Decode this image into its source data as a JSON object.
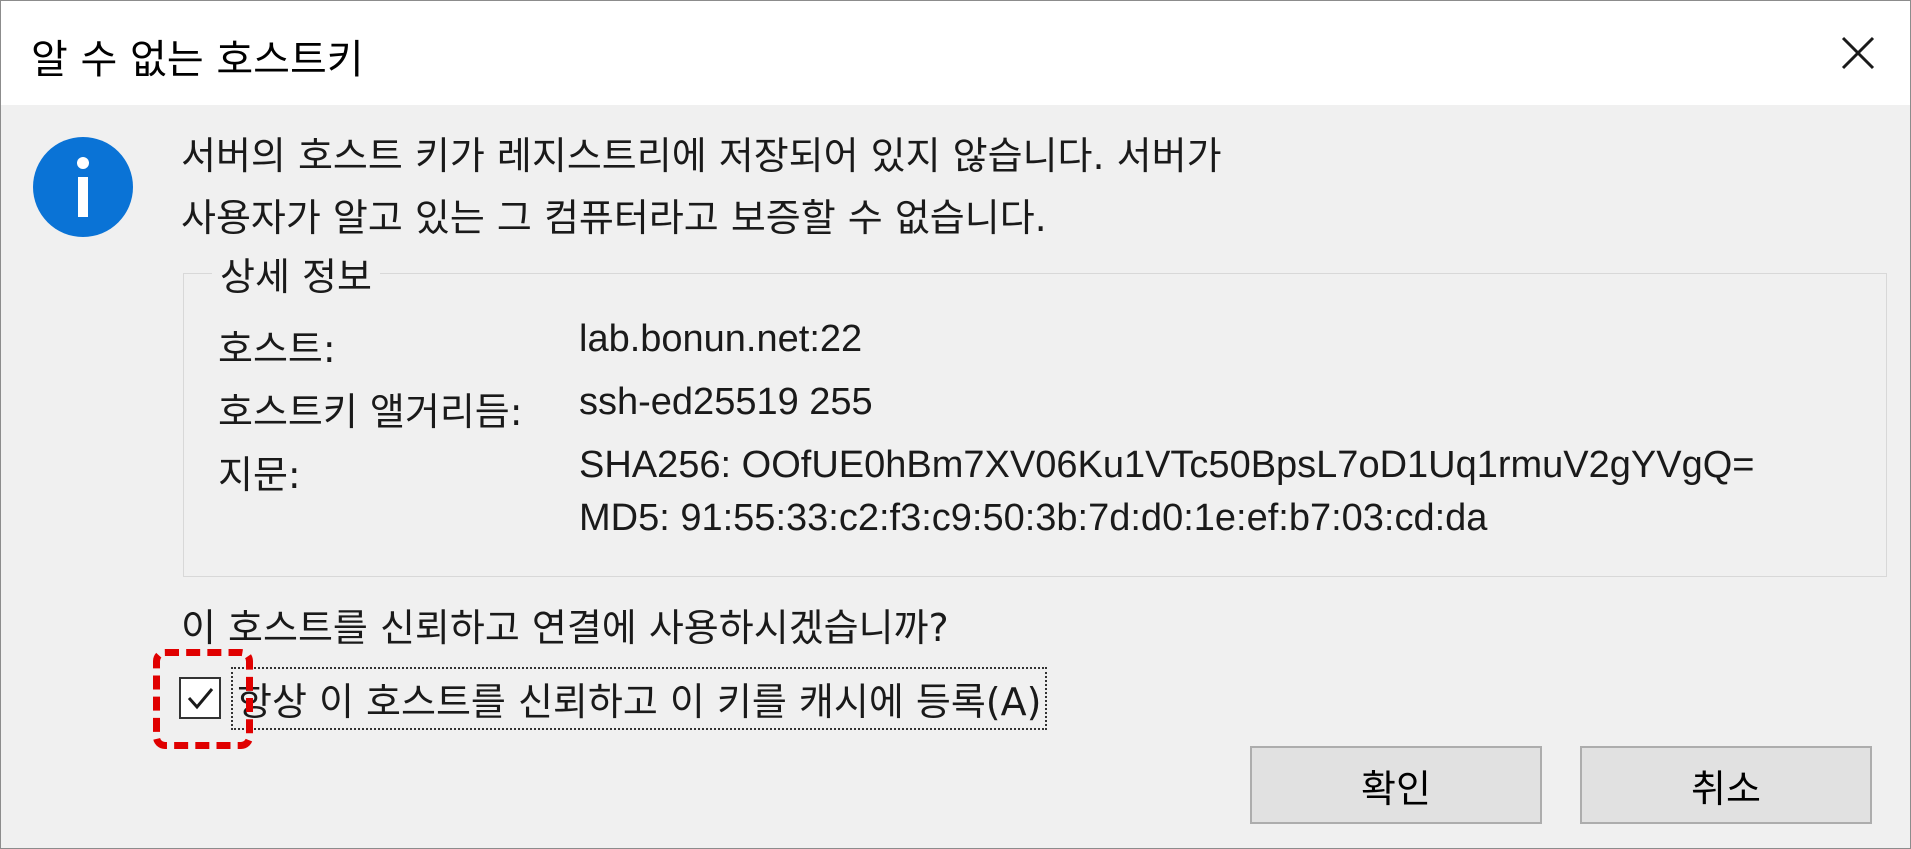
{
  "window": {
    "title": "알 수 없는 호스트키"
  },
  "message": {
    "line1": "서버의 호스트 키가 레지스트리에 저장되어 있지 않습니다. 서버가",
    "line2": "사용자가 알고 있는 그 컴퓨터라고 보증할 수 없습니다."
  },
  "details": {
    "legend": "상세 정보",
    "host_label": "호스트:",
    "host_value": "lab.bonun.net:22",
    "algorithm_label": "호스트키 앨거리듬:",
    "algorithm_value": "ssh-ed25519 255",
    "fingerprint_label": "지문:",
    "fingerprint_sha256": "SHA256: OOfUE0hBm7XV06Ku1VTc50BpsL7oD1Uq1rmuV2gYVgQ=",
    "fingerprint_md5": "MD5: 91:55:33:c2:f3:c9:50:3b:7d:d0:1e:ef:b7:03:cd:da"
  },
  "question": "이 호스트를 신뢰하고 연결에 사용하시겠습니까?",
  "checkbox": {
    "label": "항상 이 호스트를 신뢰하고 이 키를 캐시에 등록(A)",
    "checked": true
  },
  "buttons": {
    "ok": "확인",
    "cancel": "취소"
  },
  "icons": {
    "info": "info-icon",
    "close": "close-icon",
    "check": "checkmark-icon"
  },
  "colors": {
    "info_blue": "#0a73d6",
    "highlight_red": "#e00000"
  }
}
